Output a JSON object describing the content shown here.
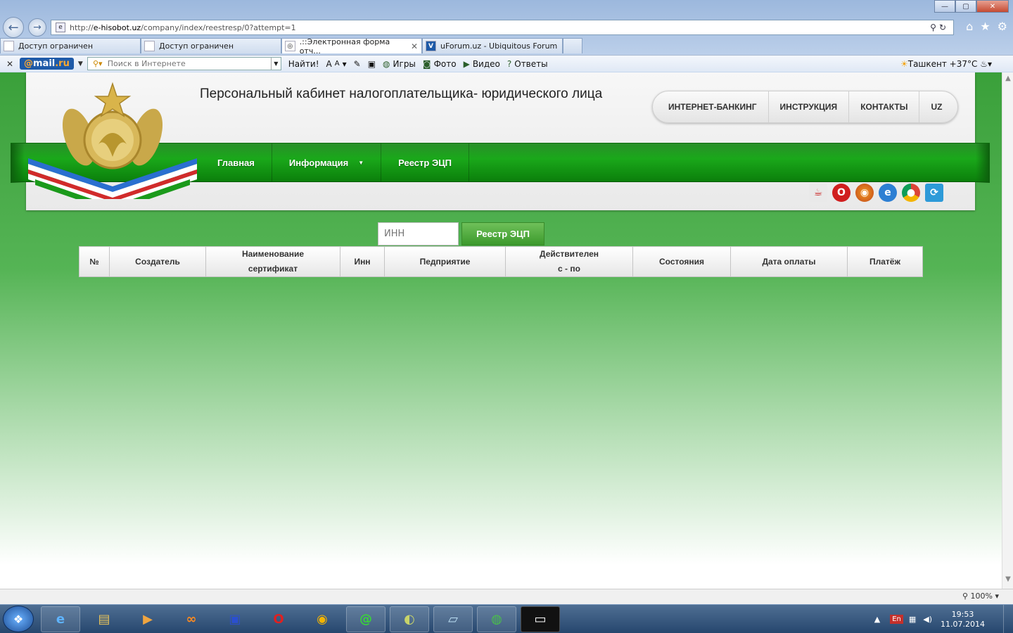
{
  "window": {
    "controls": [
      "—",
      "▢",
      "✕"
    ]
  },
  "address_bar": {
    "url_prefix": "http://",
    "url_host": "e-hisobot.uz",
    "url_path": "/company/index/reestresp/0?attempt=1"
  },
  "tabs": [
    {
      "label": "Доступ ограничен"
    },
    {
      "label": "Доступ ограничен"
    },
    {
      "label": ".::Электронная форма отч...",
      "active": true
    },
    {
      "label": "uForum.uz - Ubiquitous Forum"
    }
  ],
  "toolbar": {
    "logo_prefix": "@",
    "logo_main": "mail",
    "logo_suffix": ".ru",
    "search_placeholder": "Поиск в Интернете",
    "find_label": "Найти!",
    "items": [
      {
        "icon": "globe-icon",
        "label": "Игры"
      },
      {
        "icon": "camera-icon",
        "label": "Фото"
      },
      {
        "icon": "video-icon",
        "label": "Видео"
      },
      {
        "icon": "question-icon",
        "label": "Ответы"
      }
    ],
    "weather": "Ташкент +37°C"
  },
  "site": {
    "title": "Персональный кабинет налогоплательщика- юридического лица",
    "top_links": [
      "ИНТЕРНЕТ-БАНКИНГ",
      "ИНСТРУКЦИЯ",
      "КОНТАКТЫ",
      "UZ"
    ],
    "nav": [
      {
        "label": "Главная"
      },
      {
        "label": "Информация",
        "has_dropdown": true
      },
      {
        "label": "Реестр ЭЦП"
      }
    ],
    "browser_icons": [
      "java-icon",
      "opera-icon",
      "firefox-icon",
      "ie-icon",
      "chrome-icon",
      "applet-icon"
    ],
    "search": {
      "inn_placeholder": "ИНН",
      "button_label": "Реестр ЭЦП"
    },
    "table_headers": [
      {
        "l1": "№",
        "l2": ""
      },
      {
        "l1": "Создатель",
        "l2": ""
      },
      {
        "l1": "Наименование",
        "l2": "сертификат"
      },
      {
        "l1": "Инн",
        "l2": ""
      },
      {
        "l1": "Педприятие",
        "l2": ""
      },
      {
        "l1": "Действителен",
        "l2": "с - по"
      },
      {
        "l1": "Состояния",
        "l2": ""
      },
      {
        "l1": "Дата оплаты",
        "l2": ""
      },
      {
        "l1": "Платёж",
        "l2": ""
      }
    ]
  },
  "statusbar": {
    "zoom": "100%"
  },
  "taskbar": {
    "apps": [
      "ie-icon",
      "explorer-icon",
      "media-player-icon",
      "agent-icon",
      "floppy-icon",
      "opera-icon",
      "chrome-icon",
      "mail-agent-icon",
      "tor-icon",
      "notepad-icon",
      "globe-icon",
      "cmd-icon"
    ],
    "tray_lang": "En",
    "time": "19:53",
    "date": "11.07.2014"
  },
  "colors": {
    "page_green": "#3aa03a",
    "nav_green": "#1aa81a",
    "button_green": "#4da63a",
    "chrome_blue": "#9cb8dd"
  }
}
